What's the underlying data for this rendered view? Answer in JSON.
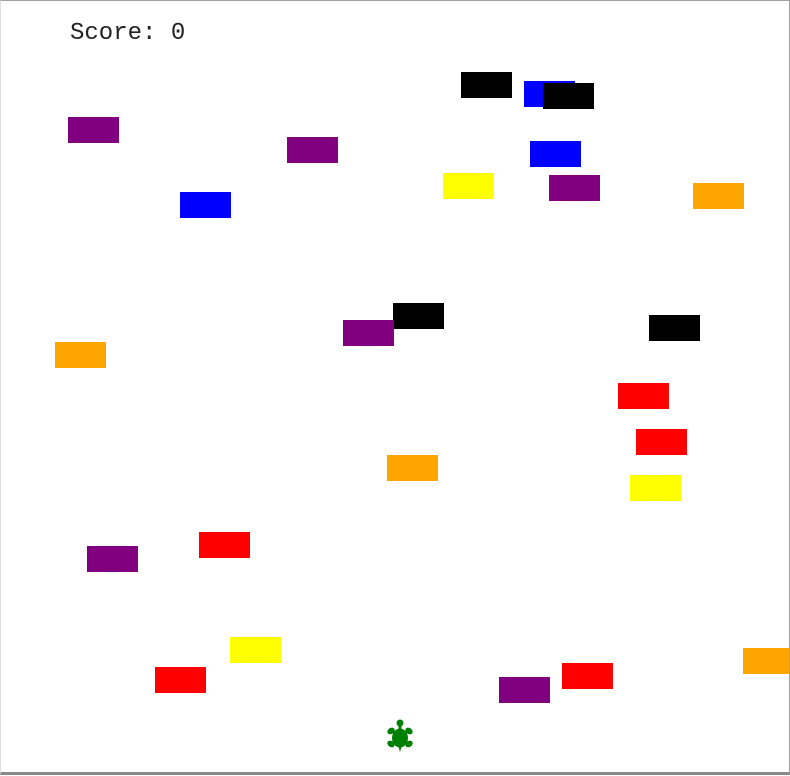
{
  "score": {
    "label": "Score:",
    "value": "0"
  },
  "colors": {
    "black": "#000000",
    "blue": "#0000ff",
    "purple": "#800080",
    "yellow": "#ffff00",
    "orange": "#ffa500",
    "red": "#ff0000",
    "turtle": "#008000"
  },
  "player": {
    "shape": "turtle-icon",
    "color": "#008000"
  },
  "blocks": [
    {
      "color": "black"
    },
    {
      "color": "blue"
    },
    {
      "color": "black"
    },
    {
      "color": "purple"
    },
    {
      "color": "purple"
    },
    {
      "color": "blue"
    },
    {
      "color": "yellow"
    },
    {
      "color": "purple"
    },
    {
      "color": "blue"
    },
    {
      "color": "orange"
    },
    {
      "color": "black"
    },
    {
      "color": "purple"
    },
    {
      "color": "black"
    },
    {
      "color": "orange"
    },
    {
      "color": "red"
    },
    {
      "color": "red"
    },
    {
      "color": "orange"
    },
    {
      "color": "yellow"
    },
    {
      "color": "red"
    },
    {
      "color": "purple"
    },
    {
      "color": "yellow"
    },
    {
      "color": "red"
    },
    {
      "color": "red"
    },
    {
      "color": "purple"
    },
    {
      "color": "orange"
    }
  ]
}
